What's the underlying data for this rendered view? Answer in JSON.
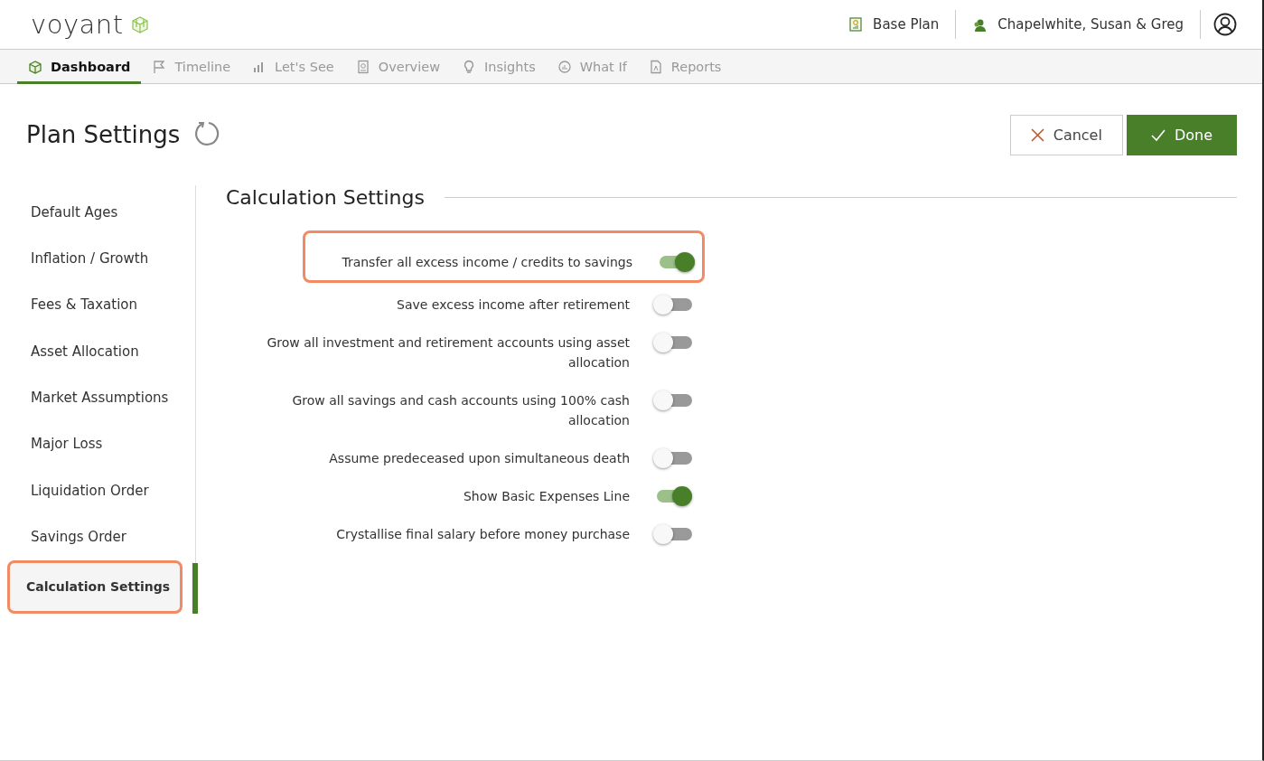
{
  "header": {
    "logo": "voyant",
    "plan": "Base Plan",
    "client": "Chapelwhite, Susan & Greg"
  },
  "tabs": [
    {
      "label": "Dashboard",
      "selected": true
    },
    {
      "label": "Timeline",
      "selected": false
    },
    {
      "label": "Let's See",
      "selected": false
    },
    {
      "label": "Overview",
      "selected": false
    },
    {
      "label": "Insights",
      "selected": false
    },
    {
      "label": "What If",
      "selected": false
    },
    {
      "label": "Reports",
      "selected": false
    }
  ],
  "page": {
    "title": "Plan Settings",
    "buttons": [
      {
        "label": "Cancel",
        "kind": "secondary"
      },
      {
        "label": "Done",
        "kind": "primary"
      }
    ]
  },
  "sidebar": {
    "items": [
      {
        "label": "Default Ages",
        "selected": false,
        "highlighted": false
      },
      {
        "label": "Inflation / Growth",
        "selected": false,
        "highlighted": false
      },
      {
        "label": "Fees & Taxation",
        "selected": false,
        "highlighted": false
      },
      {
        "label": "Asset Allocation",
        "selected": false,
        "highlighted": false
      },
      {
        "label": "Market Assumptions",
        "selected": false,
        "highlighted": false
      },
      {
        "label": "Major Loss",
        "selected": false,
        "highlighted": false
      },
      {
        "label": "Liquidation Order",
        "selected": false,
        "highlighted": false
      },
      {
        "label": "Savings Order",
        "selected": false,
        "highlighted": false
      },
      {
        "label": "Calculation Settings",
        "selected": true,
        "highlighted": true
      }
    ]
  },
  "section": {
    "title": "Calculation Settings",
    "settings": [
      {
        "label": "Transfer all excess income / credits to savings",
        "on": true,
        "highlighted": true
      },
      {
        "label": "Save excess income after retirement",
        "on": false,
        "highlighted": false
      },
      {
        "label": "Grow all investment and retirement accounts using asset allocation",
        "on": false,
        "highlighted": false
      },
      {
        "label": "Grow all savings and cash accounts using 100% cash allocation",
        "on": false,
        "highlighted": false
      },
      {
        "label": "Assume predeceased upon simultaneous death",
        "on": false,
        "highlighted": false
      },
      {
        "label": "Show Basic Expenses Line",
        "on": true,
        "highlighted": false
      },
      {
        "label": "Crystallise final salary before money purchase",
        "on": false,
        "highlighted": false
      }
    ]
  }
}
